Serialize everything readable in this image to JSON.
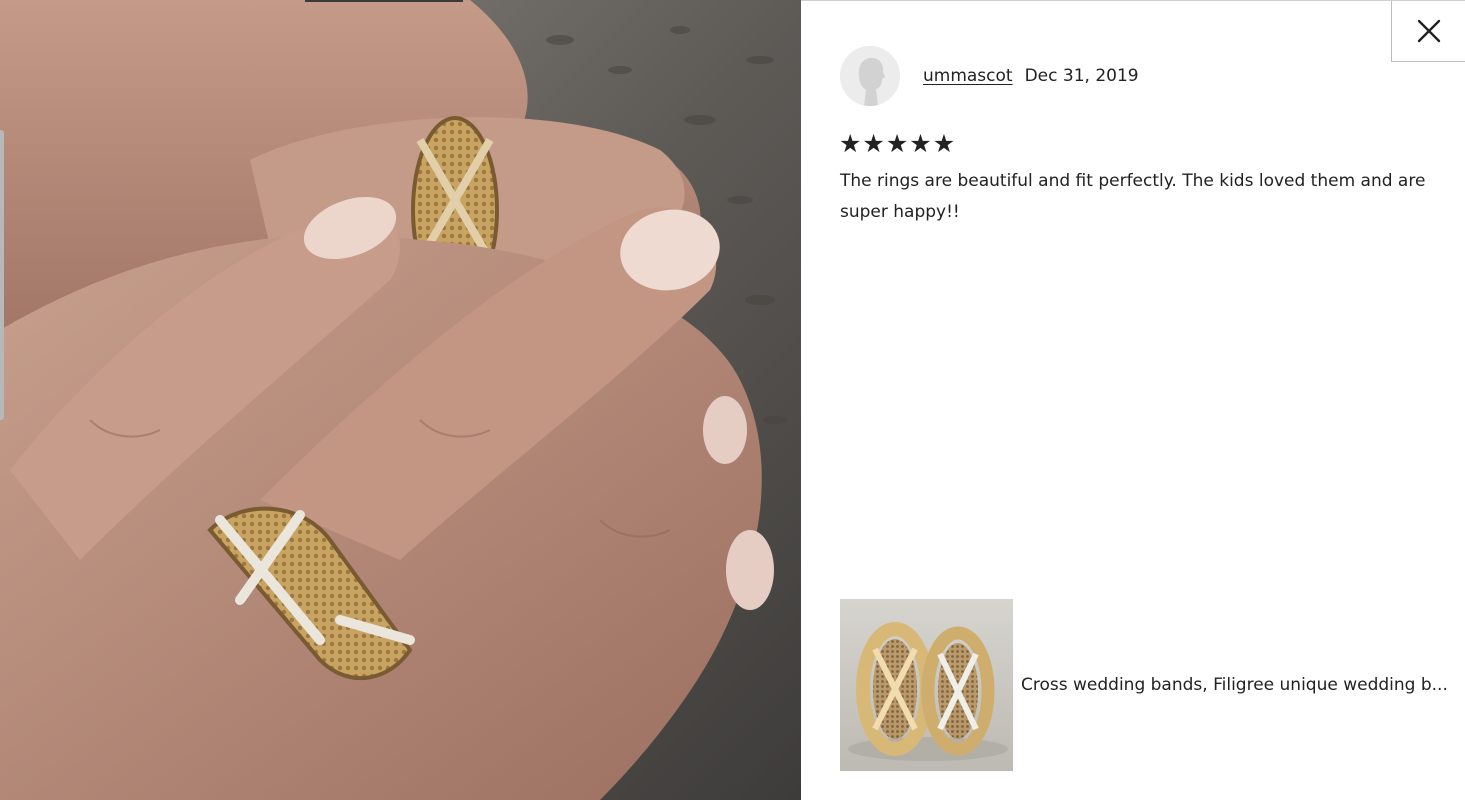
{
  "photo": {
    "description_icon": "customer-photo"
  },
  "close": {
    "icon": "close-icon"
  },
  "review": {
    "username": "ummascot",
    "date": "Dec 31, 2019",
    "rating": 5,
    "rating_max": 5,
    "stars": [
      "★",
      "★",
      "★",
      "★",
      "★"
    ],
    "text": "The rings are beautiful and fit perfectly. The kids loved them and are super happy!!"
  },
  "product": {
    "title": "Cross wedding bands, Filigree unique wedding b..."
  },
  "colors": {
    "text": "#222222",
    "border": "#bdbdbd",
    "gold": "#c9a461"
  }
}
